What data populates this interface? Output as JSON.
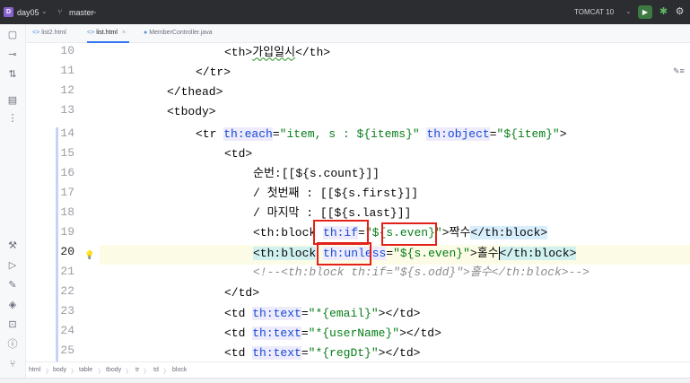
{
  "project": {
    "badge": "D",
    "name": "day05"
  },
  "vcs": {
    "branch": "master"
  },
  "run": {
    "config": "TOMCAT 10"
  },
  "tabs": [
    {
      "label": "list2.html",
      "active": false
    },
    {
      "label": "list.html",
      "active": true
    },
    {
      "label": "MemberController.java",
      "active": false
    }
  ],
  "editor": {
    "line_numbers": [
      "10",
      "11",
      "12",
      "13",
      "14",
      "15",
      "16",
      "17",
      "18",
      "19",
      "20",
      "21",
      "22",
      "23",
      "24",
      "25"
    ],
    "current_line": "20",
    "reader_mode_hint": "Reader Mode icon",
    "lines": {
      "l10": {
        "a": "<th>",
        "b": "가입일시",
        "c": "</th>"
      },
      "l11": {
        "a": "</tr>"
      },
      "l12": {
        "a": "</thead>"
      },
      "l13": {
        "a": "<tbody>"
      },
      "l14": {
        "tag": "<tr ",
        "attr1": "th:each",
        "eq1": "=",
        "val1": "\"item, s : ${items}\"",
        "sp": " ",
        "attr2": "th:object",
        "eq2": "=",
        "val2": "\"${item}\"",
        "end": ">"
      },
      "l15": {
        "a": "<td>"
      },
      "l16": {
        "a": "순번:[[${s.count}]]"
      },
      "l17": {
        "a": "/ 첫번째 : [[${s.first}]]"
      },
      "l18": {
        "a": "/ 마지막 : [[${s.last}]]"
      },
      "l19": {
        "open": "<th:block",
        "sp": " ",
        "attr": "th:if",
        "eq": "=",
        "val": "\"${s.even}\"",
        "gt": ">",
        "text": "짝수",
        "close": "</th:block>"
      },
      "l20": {
        "open": "<th:block",
        "sp": " ",
        "attr": "th:unless",
        "eq": "=",
        "val": "\"${s.even}\"",
        "gt": ">",
        "text": "홀수",
        "close": "</th:block>"
      },
      "l21": {
        "a": "<!--<th:block th:if=\"${s.odd}\">홀수</th:block>-->"
      },
      "l22": {
        "a": "</td>"
      },
      "l23": {
        "open": "<td ",
        "attr": "th:text",
        "eq": "=",
        "val": "\"*{email}\"",
        "close": "></td>"
      },
      "l24": {
        "open": "<td ",
        "attr": "th:text",
        "eq": "=",
        "val": "\"*{userName}\"",
        "close": "></td>"
      },
      "l25": {
        "open": "<td ",
        "attr": "th:text",
        "eq": "=",
        "val": "\"*{regDt}\"",
        "close": "></td>"
      }
    }
  },
  "breadcrumb": [
    "html",
    "body",
    "table",
    "tbody",
    "tr",
    "td",
    "block"
  ],
  "colors": {
    "annotation_box": "#e32119",
    "accent": "#3574f0",
    "toolbar_bg": "#2b2d30"
  }
}
